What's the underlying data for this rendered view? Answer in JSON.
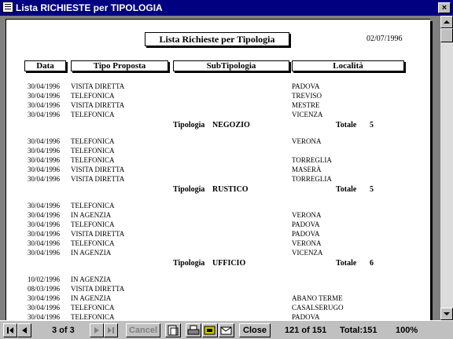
{
  "window": {
    "title": "Lista RICHIESTE per TIPOLOGIA",
    "close_glyph": "×"
  },
  "report": {
    "title": "Lista Richieste per Tipologia",
    "date": "02/07/1996",
    "headers": {
      "data": "Data",
      "tipo": "Tipo Proposta",
      "sub": "SubTipologia",
      "loc": "Località"
    },
    "groups": [
      {
        "rows": [
          {
            "data": "30/04/1996",
            "tipo": "VISITA DIRETTA",
            "loc": "PADOVA"
          },
          {
            "data": "30/04/1996",
            "tipo": "TELEFONICA",
            "loc": "TREVISO"
          },
          {
            "data": "30/04/1996",
            "tipo": "VISITA DIRETTA",
            "loc": "MESTRE"
          },
          {
            "data": "30/04/1996",
            "tipo": "TELEFONICA",
            "loc": "VICENZA"
          }
        ],
        "summary": {
          "label": "Tipologia",
          "value": "NEGOZIO",
          "total_label": "Totale",
          "total": "5"
        }
      },
      {
        "rows": [
          {
            "data": "30/04/1996",
            "tipo": "TELEFONICA",
            "loc": "VERONA"
          },
          {
            "data": "30/04/1996",
            "tipo": "TELEFONICA",
            "loc": ""
          },
          {
            "data": "30/04/1996",
            "tipo": "TELEFONICA",
            "loc": "TORREGLIA"
          },
          {
            "data": "30/04/1996",
            "tipo": "VISITA DIRETTA",
            "loc": "MASERÀ"
          },
          {
            "data": "30/04/1996",
            "tipo": "VISITA DIRETTA",
            "loc": "TORREGLIA"
          }
        ],
        "summary": {
          "label": "Tipologia",
          "value": "RUSTICO",
          "total_label": "Totale",
          "total": "5"
        }
      },
      {
        "rows": [
          {
            "data": "30/04/1996",
            "tipo": "TELEFONICA",
            "loc": ""
          },
          {
            "data": "30/04/1996",
            "tipo": "IN AGENZIA",
            "loc": "VERONA"
          },
          {
            "data": "30/04/1996",
            "tipo": "TELEFONICA",
            "loc": "PADOVA"
          },
          {
            "data": "30/04/1996",
            "tipo": "VISITA DIRETTA",
            "loc": "PADOVA"
          },
          {
            "data": "30/04/1996",
            "tipo": "TELEFONICA",
            "loc": "VERONA"
          },
          {
            "data": "30/04/1996",
            "tipo": "IN AGENZIA",
            "loc": "VICENZA"
          }
        ],
        "summary": {
          "label": "Tipologia",
          "value": "UFFICIO",
          "total_label": "Totale",
          "total": "6"
        }
      },
      {
        "rows": [
          {
            "data": "10/02/1996",
            "tipo": "IN AGENZIA",
            "loc": ""
          },
          {
            "data": "08/03/1996",
            "tipo": "VISITA DIRETTA",
            "loc": ""
          },
          {
            "data": "30/04/1996",
            "tipo": "IN AGENZIA",
            "loc": "ABANO TERME"
          },
          {
            "data": "30/04/1996",
            "tipo": "TELEFONICA",
            "loc": "CASALSERUGO"
          },
          {
            "data": "30/04/1996",
            "tipo": "TELEFONICA",
            "loc": "PADOVA"
          }
        ],
        "summary": null
      }
    ]
  },
  "toolbar": {
    "page_status": "3 of 3",
    "cancel": "Cancel",
    "close": "Close",
    "record_status": "121 of 151",
    "total": "Total:151",
    "zoom_level": "100%"
  },
  "icons": {
    "first": "first-page-icon",
    "prev": "previous-page-icon",
    "next": "next-page-icon",
    "last": "last-page-icon",
    "zoom": "zoom-icon",
    "print": "printer-icon",
    "export": "export-icon",
    "mail": "mail-icon"
  }
}
